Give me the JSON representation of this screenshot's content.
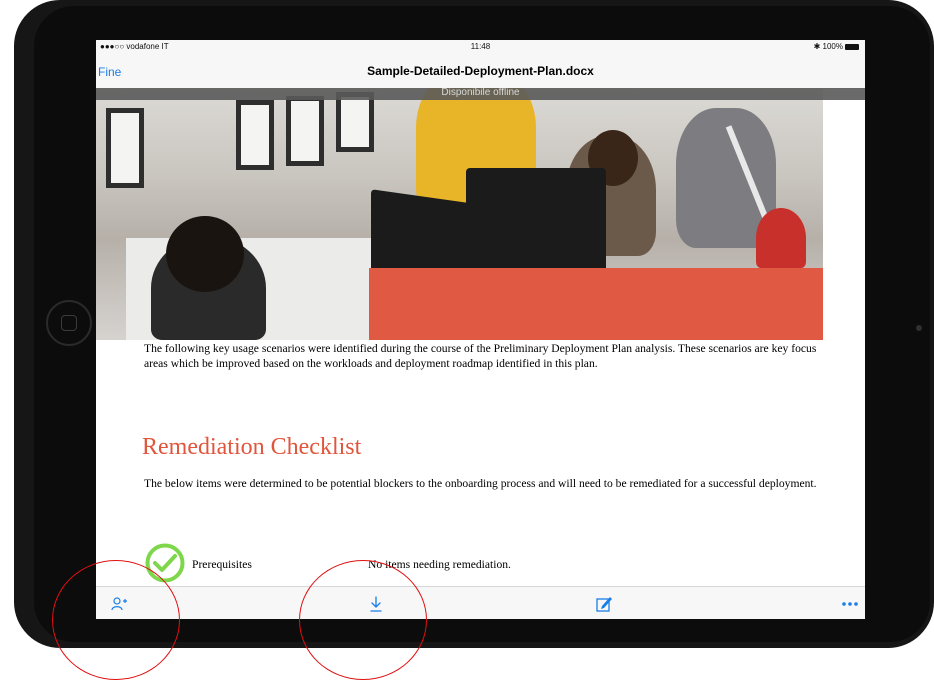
{
  "status_bar": {
    "carrier": "●●●○○ vodafone IT",
    "time": "11:48",
    "battery": "100%"
  },
  "nav_bar": {
    "done_label": "Fine",
    "title": "Sample-Detailed-Deployment-Plan.docx"
  },
  "offline_banner": "Disponibile offline",
  "document": {
    "intro": "The following key usage scenarios were identified during the course of the Preliminary Deployment Plan analysis.  These scenarios are key focus areas which be improved based on the workloads and deployment roadmap identified in this plan.",
    "heading": "Remediation Checklist",
    "description": "The below items were determined to be potential blockers to the onboarding process and will need to be remediated for a successful deployment.",
    "checklist": [
      {
        "label": "Prerequisites",
        "status": "No items needing remediation."
      }
    ]
  },
  "toolbar": {
    "icons": [
      "add-person-icon",
      "download-icon",
      "edit-icon",
      "more-icon"
    ]
  },
  "colors": {
    "accent": "#1a7ee8",
    "heading": "#e0553c",
    "check": "#7ed64a",
    "annotation": "#e01010"
  }
}
